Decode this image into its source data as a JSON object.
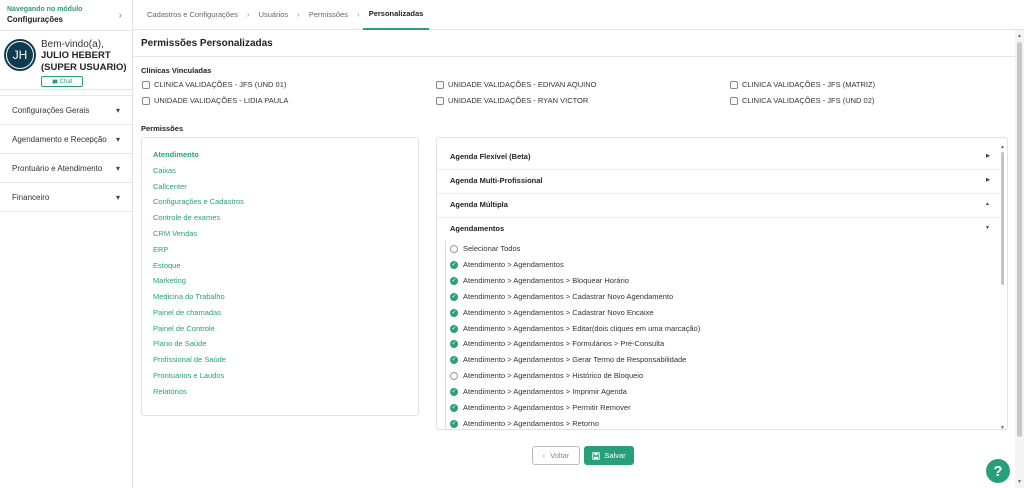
{
  "sidebar": {
    "module_caption": "Navegando no módulo",
    "module_name": "Configurações",
    "avatar_initials": "JH",
    "welcome": "Bem-vindo(a),",
    "user_name": "JULIO HEBERT (SUPER USUARIO)",
    "chat_label": "Chat",
    "menu": [
      {
        "label": "Configurações Gerais"
      },
      {
        "label": "Agendamento e Recepção"
      },
      {
        "label": "Prontuário e Atendimento"
      },
      {
        "label": "Financeiro"
      }
    ]
  },
  "breadcrumb": [
    "Cadastros e Configurações",
    "Usuários",
    "Permissões",
    "Personalizadas"
  ],
  "page": {
    "title": "Permissões Personalizadas",
    "clinics_label": "Clínicas Vinculadas",
    "permissions_label": "Permissões"
  },
  "clinics": [
    "CLINICA VALIDAÇÕES - JFS (UND 01)",
    "UNIDADE VALIDAÇÕES - EDIVAN AQUINO",
    "CLINICA VALIDAÇÕES - JFS (MATRIZ)",
    "UNIDADE VALIDAÇÕES - LIDIA PAULA",
    "UNIDADE VALIDAÇÕES - RYAN VICTOR",
    "CLINICA VALIDAÇÕES - JFS (UND 02)"
  ],
  "categories": [
    "Atendimento",
    "Caixas",
    "Callcenter",
    "Configurações e Cadastros",
    "Controle de exames",
    "CRM Vendas",
    "ERP",
    "Estoque",
    "Marketing",
    "Medicina do Trabalho",
    "Painel de chamadas",
    "Painel de Controle",
    "Plano de Saúde",
    "Profissional de Saúde",
    "Prontuários e Laudos",
    "Relatórios"
  ],
  "groups": [
    "Agenda Flexível (Beta)",
    "Agenda Multi-Profissional",
    "Agenda Múltipla",
    "Agendamentos"
  ],
  "select_all": "Selecionar Todos",
  "permissions": [
    {
      "label": "Atendimento > Agendamentos",
      "checked": true
    },
    {
      "label": "Atendimento > Agendamentos > Bloquear Horário",
      "checked": true
    },
    {
      "label": "Atendimento > Agendamentos > Cadastrar Novo Agendamento",
      "checked": true
    },
    {
      "label": "Atendimento > Agendamentos > Cadastrar Novo Encaixe",
      "checked": true
    },
    {
      "label": "Atendimento > Agendamentos > Editar(dois cliques em uma marcação)",
      "checked": true
    },
    {
      "label": "Atendimento > Agendamentos > Formulários > Pré-Consulta",
      "checked": true
    },
    {
      "label": "Atendimento > Agendamentos > Gerar Termo de Responsabilidade",
      "checked": true
    },
    {
      "label": "Atendimento > Agendamentos > Histórico de Bloqueio",
      "checked": false
    },
    {
      "label": "Atendimento > Agendamentos > Imprimir Agenda",
      "checked": true
    },
    {
      "label": "Atendimento > Agendamentos > Permitir Remover",
      "checked": true
    },
    {
      "label": "Atendimento > Agendamentos > Retorno",
      "checked": true
    }
  ],
  "buttons": {
    "back": "Voltar",
    "save": "Salvar",
    "help": "?"
  },
  "colors": {
    "accent": "#27a07a",
    "avatar": "#0f3b4f"
  }
}
